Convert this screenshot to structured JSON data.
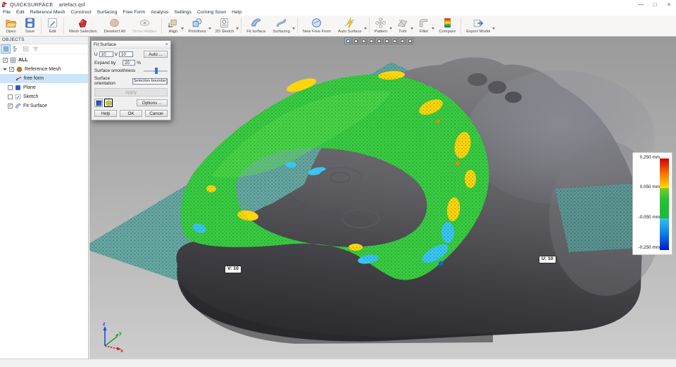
{
  "window": {
    "app_name": "QUICKSURFACE",
    "doc_name": "artefact.qsf",
    "minimize": "—",
    "maximize": "□",
    "close": "×"
  },
  "menu": {
    "items": [
      "File",
      "Edit",
      "Reference Mesh",
      "Construct",
      "Surfacing",
      "Free Form",
      "Analysis",
      "Settings",
      "Coming Soon",
      "Help"
    ]
  },
  "toolbar": {
    "buttons": [
      {
        "label": "Open"
      },
      {
        "label": "Save"
      },
      {
        "label": "Edit"
      },
      {
        "label": "Mesh Selection"
      },
      {
        "label": "Deselect All"
      },
      {
        "label": "Show Hidden"
      },
      {
        "label": "Align"
      },
      {
        "label": "Primitives"
      },
      {
        "label": "2D Sketch"
      },
      {
        "label": "Fit surface"
      },
      {
        "label": "Surfacing"
      },
      {
        "label": "New Free Form"
      },
      {
        "label": "Auto Surface"
      },
      {
        "label": "Pattern"
      },
      {
        "label": "Trim"
      },
      {
        "label": "Fillet"
      },
      {
        "label": "Compare"
      },
      {
        "label": "Export Model"
      }
    ]
  },
  "objects_panel": {
    "title": "OBJECTS",
    "check_glyph": "✓",
    "items": [
      {
        "label": "ALL",
        "checked": true
      },
      {
        "label": "Reference Mesh",
        "checked": true
      },
      {
        "label": "free form",
        "selected": true
      },
      {
        "label": "Plane",
        "checked": false
      },
      {
        "label": "Sketch",
        "checked": false
      },
      {
        "label": "Fit Surface",
        "checked": true
      }
    ]
  },
  "dialog": {
    "title": "Fit Surface",
    "close": "×",
    "u_label": "U",
    "u_value": "10",
    "v_label": "V",
    "v_value": "10",
    "auto_button": "Auto ...",
    "expand_label": "Expand by",
    "expand_value": "20",
    "expand_unit": "%",
    "smoothness_label": "Surface smoothness",
    "orientation_label": "Surface orientation",
    "orientation_value": "Selection boundar",
    "apply_button": "Apply",
    "options_button": "Options ...",
    "help_button": "Help",
    "ok_button": "OK",
    "cancel_button": "Cancel"
  },
  "viewport": {
    "v_tag": "V: 10",
    "u_tag": "U: 10",
    "legend": {
      "labels": [
        "0.250 mm",
        "0.050 mm",
        "-0.050 mm",
        "-0.250 mm"
      ]
    },
    "axes": {
      "x": "x",
      "y": "y",
      "z": "z"
    }
  },
  "colors": {
    "surface_teal": "#58a39e",
    "deviation_green": "#38cc40",
    "deviation_yellow": "#ffd60a",
    "deviation_cyan": "#39c6f2",
    "legend_top": "#cf0000",
    "legend_bottom": "#0617cc",
    "model_gray": "#4a4a4e",
    "selection_blue": "#cde5fb"
  }
}
